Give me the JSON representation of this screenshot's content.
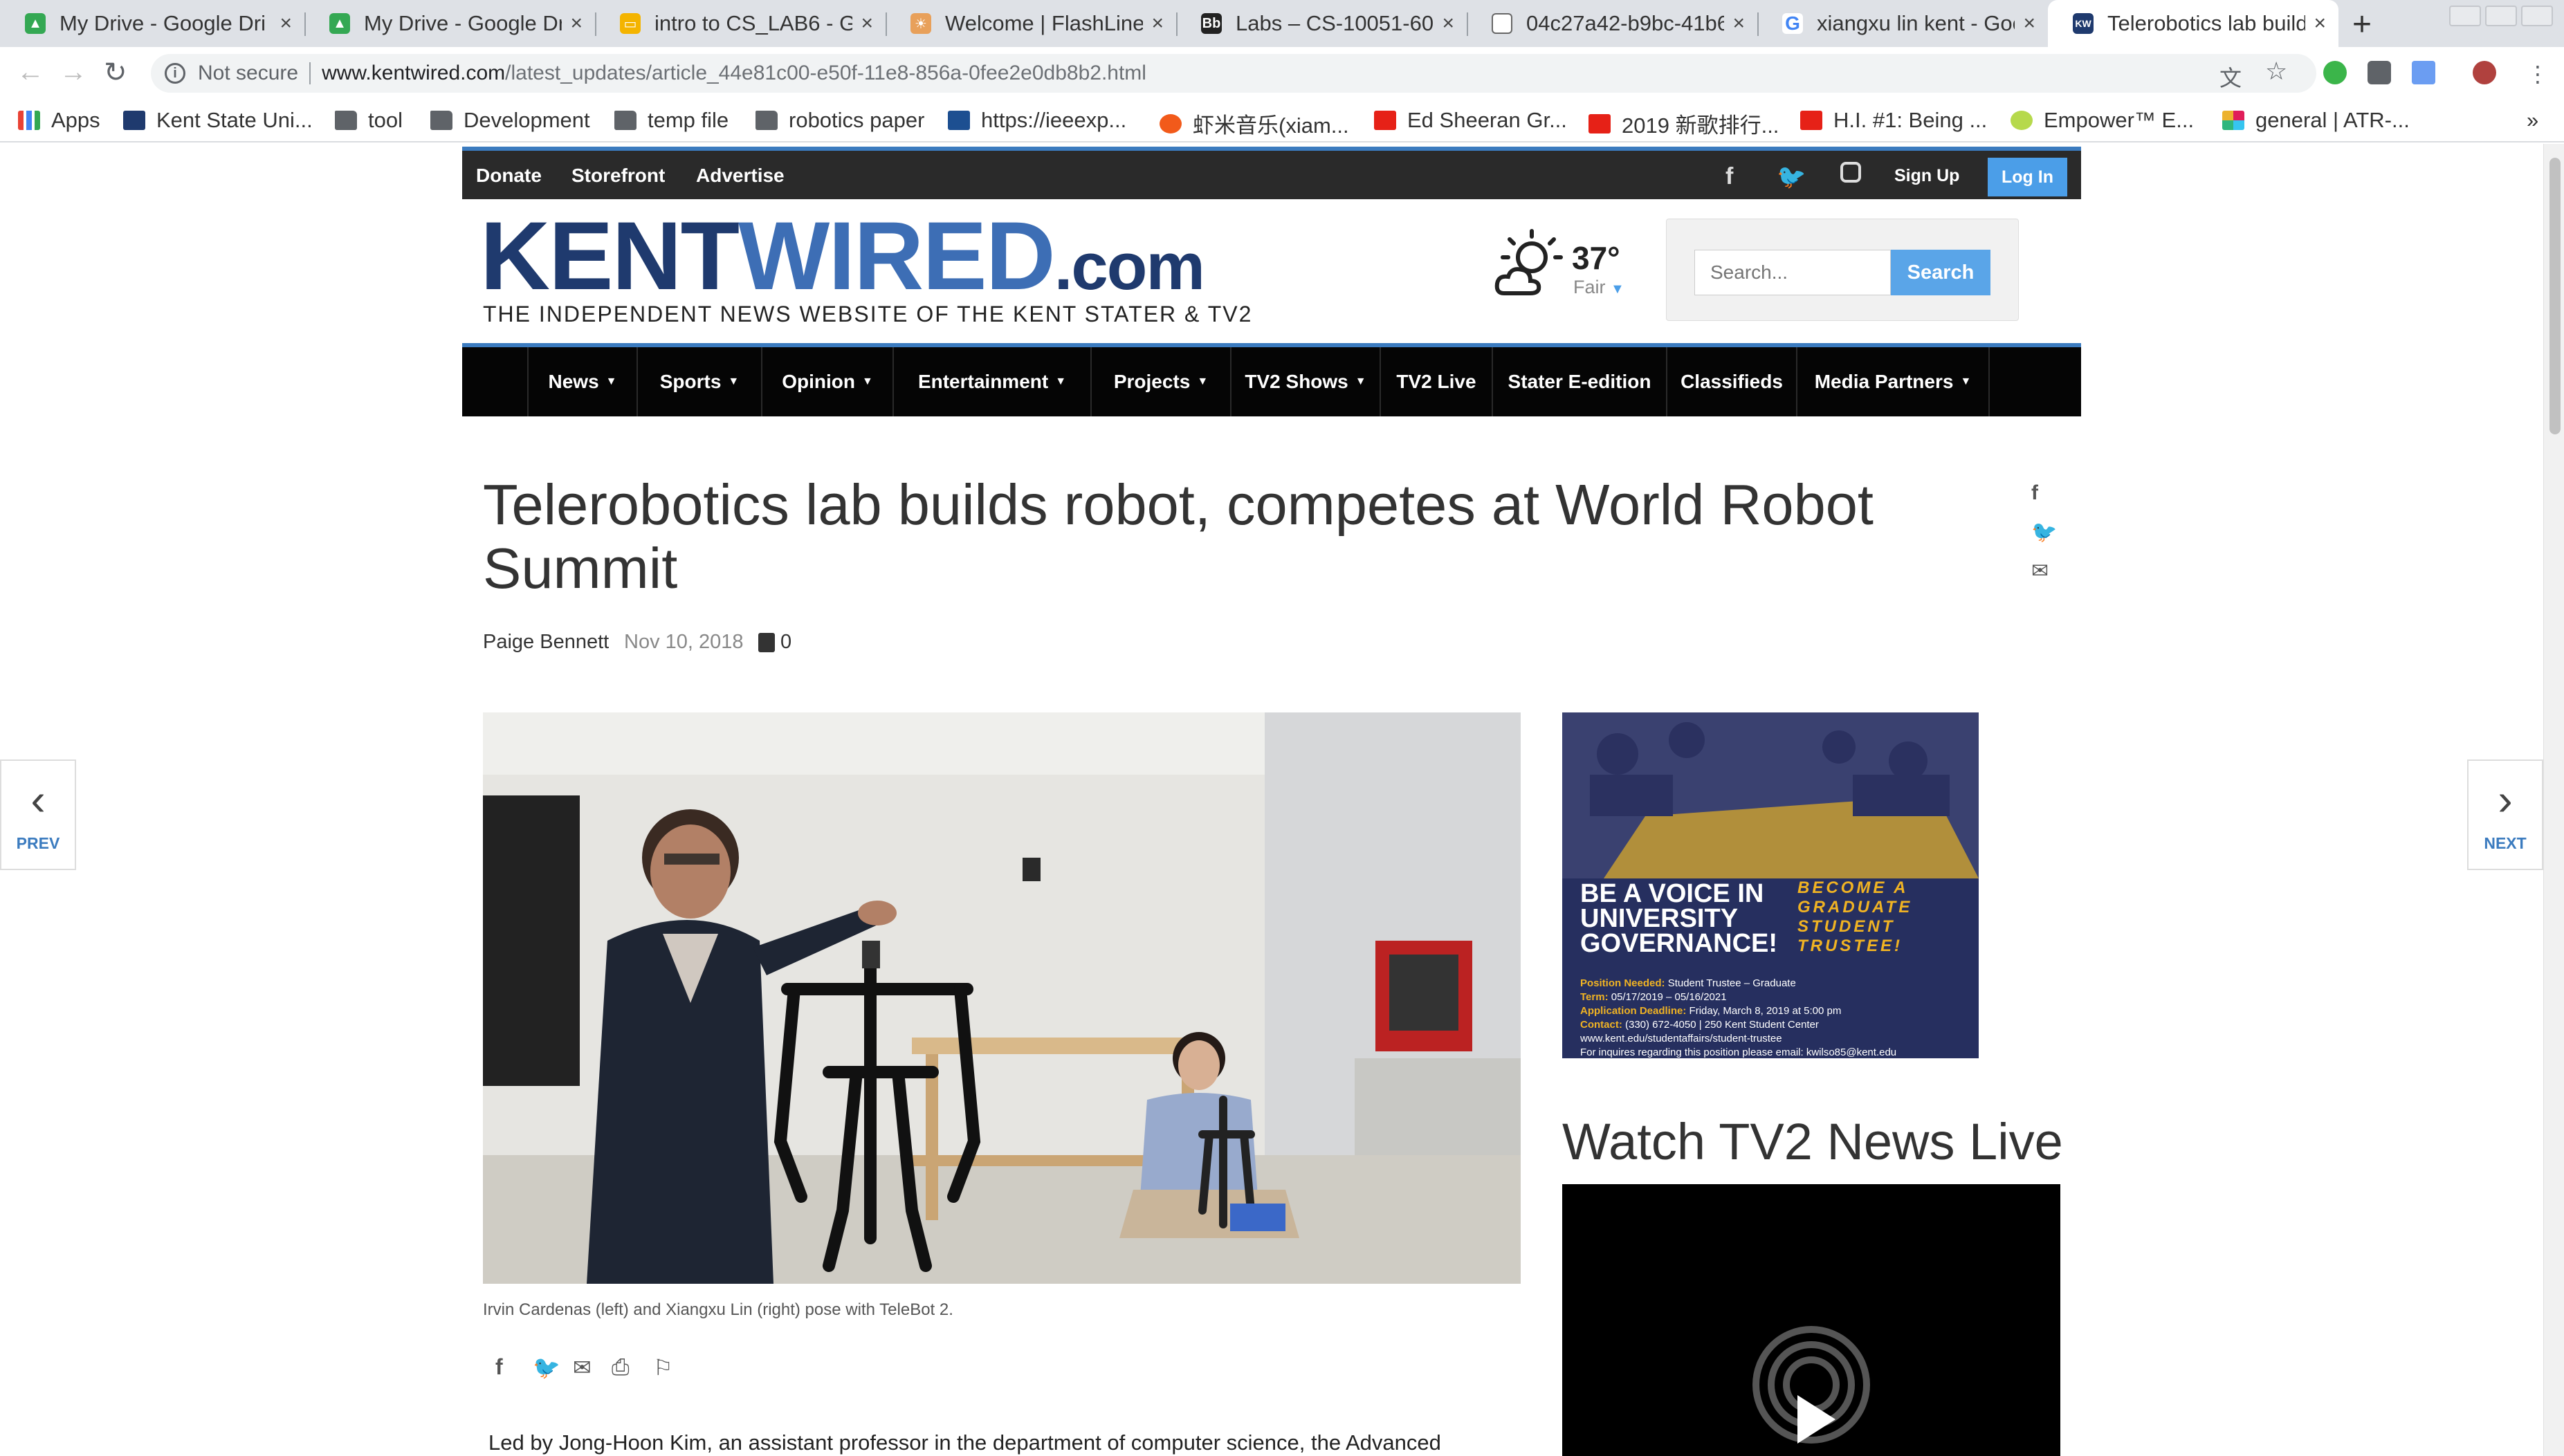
{
  "browser": {
    "tabs": [
      {
        "title": "My Drive - Google Dri",
        "icon": "google-drive-icon"
      },
      {
        "title": "My Drive - Google Dri",
        "icon": "google-drive-icon"
      },
      {
        "title": "intro to CS_LAB6 - Go",
        "icon": "google-slides-icon"
      },
      {
        "title": "Welcome | FlashLine",
        "icon": "flashline-icon"
      },
      {
        "title": "Labs – CS-10051-600",
        "icon": "blackboard-icon"
      },
      {
        "title": "04c27a42-b9bc-41b6",
        "icon": "document-icon"
      },
      {
        "title": "xiangxu lin kent - Goo",
        "icon": "google-icon"
      },
      {
        "title": "Telerobotics lab build",
        "icon": "kentwired-icon"
      }
    ],
    "new_tab_label": "+",
    "tab_close_glyph": "×",
    "address": {
      "security": "Not secure",
      "host": "www.kentwired.com",
      "path": "/latest_updates/article_44e81c00-e50f-11e8-856a-0fee2e0db8b2.html"
    },
    "bookmarks": [
      {
        "label": "Apps",
        "icon": "apps-grid-icon"
      },
      {
        "label": "Kent State Uni...",
        "icon": "kent-state-icon"
      },
      {
        "label": "tool",
        "icon": "folder-icon"
      },
      {
        "label": "Development",
        "icon": "folder-icon"
      },
      {
        "label": "temp file",
        "icon": "folder-icon"
      },
      {
        "label": "robotics paper",
        "icon": "folder-icon"
      },
      {
        "label": "https://ieeexp...",
        "icon": "ieee-icon"
      },
      {
        "label": "虾米音乐(xiam...",
        "icon": "xiami-icon"
      },
      {
        "label": "Ed Sheeran Gr...",
        "icon": "youtube-icon"
      },
      {
        "label": "2019 新歌排行...",
        "icon": "youtube-icon"
      },
      {
        "label": "H.I. #1: Being ...",
        "icon": "youtube-icon"
      },
      {
        "label": "Empower™ E...",
        "icon": "empower-icon"
      },
      {
        "label": "general | ATR-...",
        "icon": "slack-icon"
      }
    ],
    "bookmarks_overflow": "»"
  },
  "site": {
    "topbar_links": [
      "Donate",
      "Storefront",
      "Advertise"
    ],
    "signup": "Sign Up",
    "login": "Log In",
    "logo": {
      "kent": "KENT",
      "wired": "WIRED",
      "com": ".com",
      "tagline": "THE INDEPENDENT NEWS WEBSITE OF THE KENT STATER & TV2"
    },
    "weather": {
      "temp": "37°",
      "condition": "Fair"
    },
    "search": {
      "placeholder": "Search...",
      "button": "Search"
    },
    "nav": [
      {
        "label": "News",
        "caret": true
      },
      {
        "label": "Sports",
        "caret": true
      },
      {
        "label": "Opinion",
        "caret": true
      },
      {
        "label": "Entertainment",
        "caret": true
      },
      {
        "label": "Projects",
        "caret": true
      },
      {
        "label": "TV2 Shows",
        "caret": true
      },
      {
        "label": "TV2 Live",
        "caret": false
      },
      {
        "label": "Stater E-edition",
        "caret": false
      },
      {
        "label": "Classifieds",
        "caret": false
      },
      {
        "label": "Media Partners",
        "caret": true
      }
    ]
  },
  "article": {
    "headline": "Telerobotics lab builds robot, competes at World Robot Summit",
    "author": "Paige Bennett",
    "date": "Nov 10, 2018",
    "comment_count": "0",
    "caption": "Irvin Cardenas (left) and Xiangxu Lin (right) pose with TeleBot 2.",
    "body_first_line": "Led by Jong-Hoon Kim, an assistant professor in the department of computer science, the Advanced"
  },
  "sidebar": {
    "ad": {
      "left_text": [
        "BE A VOICE IN",
        "UNIVERSITY",
        "GOVERNANCE!"
      ],
      "right_text": [
        "BECOME A",
        "GRADUATE",
        "STUDENT",
        "TRUSTEE!"
      ],
      "details": [
        {
          "label": "Position Needed:",
          "value": "Student Trustee – Graduate"
        },
        {
          "label": "Term:",
          "value": "05/17/2019 – 05/16/2021"
        },
        {
          "label": "Application Deadline:",
          "value": "Friday, March 8, 2019 at 5:00 pm"
        },
        {
          "label": "Contact:",
          "value": "(330) 672-4050 | 250 Kent Student Center"
        },
        {
          "label": "",
          "value": "www.kent.edu/studentaffairs/student-trustee"
        },
        {
          "label": "",
          "value": "For inquires regarding this position please email: kwilso85@kent.edu"
        }
      ]
    },
    "tv2_title": "Watch TV2 News Live"
  },
  "pager": {
    "prev": "PREV",
    "next": "NEXT"
  },
  "colors": {
    "brand_dark": "#1f3a6e",
    "brand_light": "#3d6eb5",
    "accent": "#3b7bbf",
    "login": "#4b9ee8",
    "ad_bg": "#262f5f",
    "ad_gold": "#f0b323"
  }
}
